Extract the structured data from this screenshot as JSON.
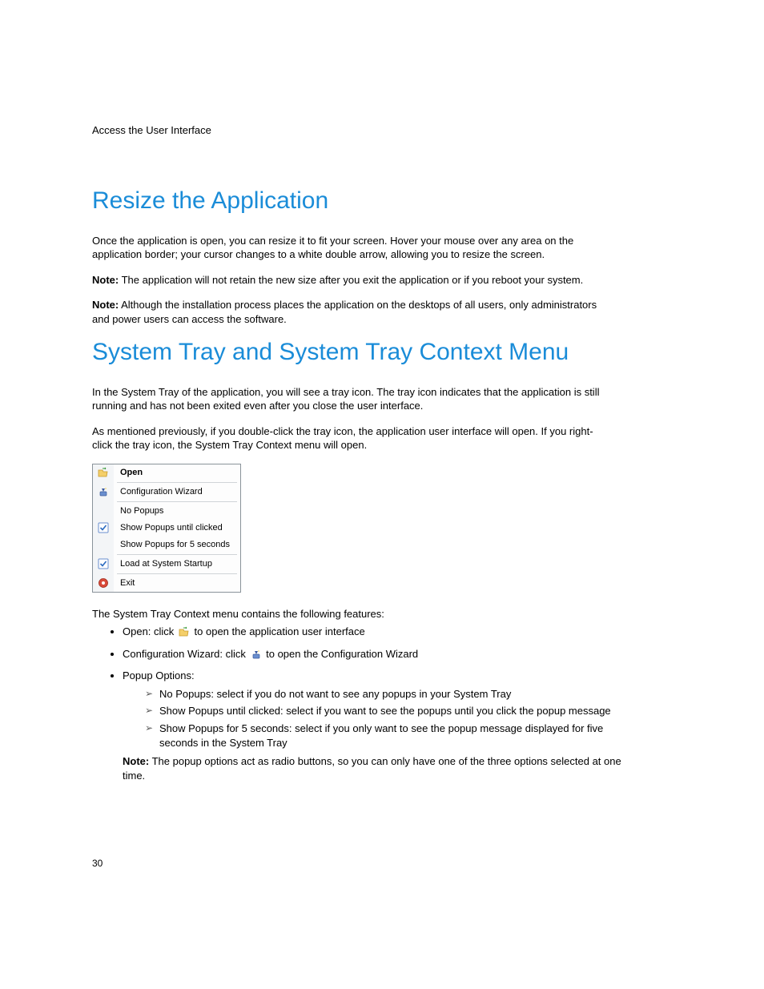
{
  "header": "Access the User Interface",
  "page_number": "30",
  "section1": {
    "title": "Resize the Application",
    "para1": "Once the application is open, you can resize it to fit your screen. Hover your mouse over any area on the application border; your cursor changes to a white double arrow, allowing you to resize the screen.",
    "note1_label": "Note:",
    "note1_text": " The application will not retain the new size after you exit the application or if you reboot your system.",
    "note2_label": "Note:",
    "note2_text": " Although the installation process places the application on the desktops of all users, only administrators and power users can access the software."
  },
  "section2": {
    "title": "System Tray and System Tray Context Menu",
    "para1": "In the System Tray of the application, you will see a tray icon. The tray icon indicates that the application is still running and has not been exited even after you close the user interface.",
    "para2": "As mentioned previously, if you double-click the tray icon, the application user interface will open. If you right-click the tray icon, the System Tray Context menu will open.",
    "menu": {
      "open": "Open",
      "config": "Configuration Wizard",
      "no_popups": "No Popups",
      "show_until": "Show Popups until clicked",
      "show_5": "Show Popups for 5 seconds",
      "load": "Load at System Startup",
      "exit": "Exit"
    },
    "para3": "The System Tray Context menu contains the following features:",
    "feat_open_pre": "Open: click ",
    "feat_open_post": " to open the application user interface",
    "feat_config_pre": "Configuration Wizard: click ",
    "feat_config_post": " to open the Configuration Wizard",
    "feat_popup": "Popup Options:",
    "sub_no": "No Popups: select if you do not want to see any popups in your System Tray",
    "sub_until": "Show Popups until clicked: select if you want to see the popups until you click the popup message",
    "sub_5": "Show Popups for 5 seconds: select if you only want to see the popup message displayed for five seconds in the System Tray",
    "subnote_label": "Note:",
    "subnote_text": " The popup options act as radio buttons, so you can only have one of the three options selected at one time."
  }
}
